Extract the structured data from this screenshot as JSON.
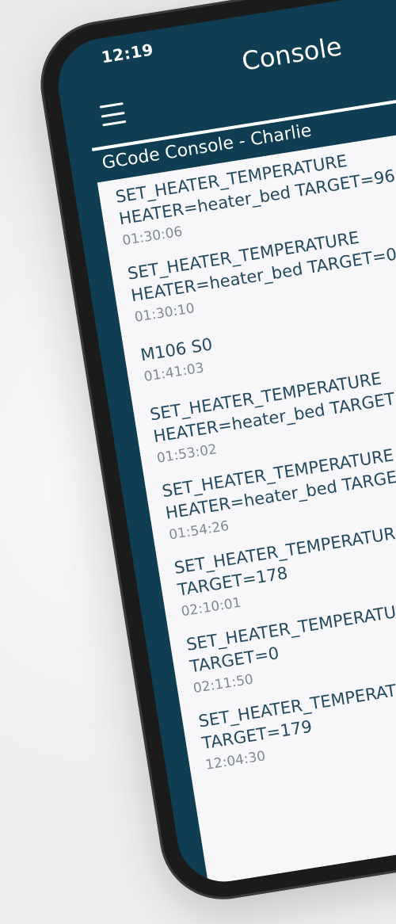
{
  "status_bar": {
    "time": "12:19"
  },
  "app_bar": {
    "title": "Console"
  },
  "subheader": {
    "title": "GCode Console - Charlie"
  },
  "entries": [
    {
      "line1": "SET_HEATER_TEMPERATURE",
      "line2": "HEATER=heater_bed TARGET=96",
      "time": "01:30:06"
    },
    {
      "line1": "SET_HEATER_TEMPERATURE",
      "line2": "HEATER=heater_bed TARGET=0",
      "time": "01:30:10"
    },
    {
      "line1": "M106 S0",
      "line2": "",
      "time": "01:41:03"
    },
    {
      "line1": "SET_HEATER_TEMPERATURE",
      "line2": "HEATER=heater_bed TARGET=",
      "time": "01:53:02"
    },
    {
      "line1": "SET_HEATER_TEMPERATURE",
      "line2": "HEATER=heater_bed TARGET=",
      "time": "01:54:26"
    },
    {
      "line1": "SET_HEATER_TEMPERATURE",
      "line2": "TARGET=178",
      "time": "02:10:01"
    },
    {
      "line1": "SET_HEATER_TEMPERATURE",
      "line2": "TARGET=0",
      "time": "02:11:50"
    },
    {
      "line1": "SET_HEATER_TEMPERATURE",
      "line2": "TARGET=179",
      "time": "12:04:30"
    }
  ],
  "icons": {
    "menu": "hamburger-menu-icon"
  },
  "colors": {
    "primary": "#0f3e52",
    "background": "#f7f7f9",
    "command_text": "#234a5e",
    "timestamp_text": "#7e8a90"
  }
}
